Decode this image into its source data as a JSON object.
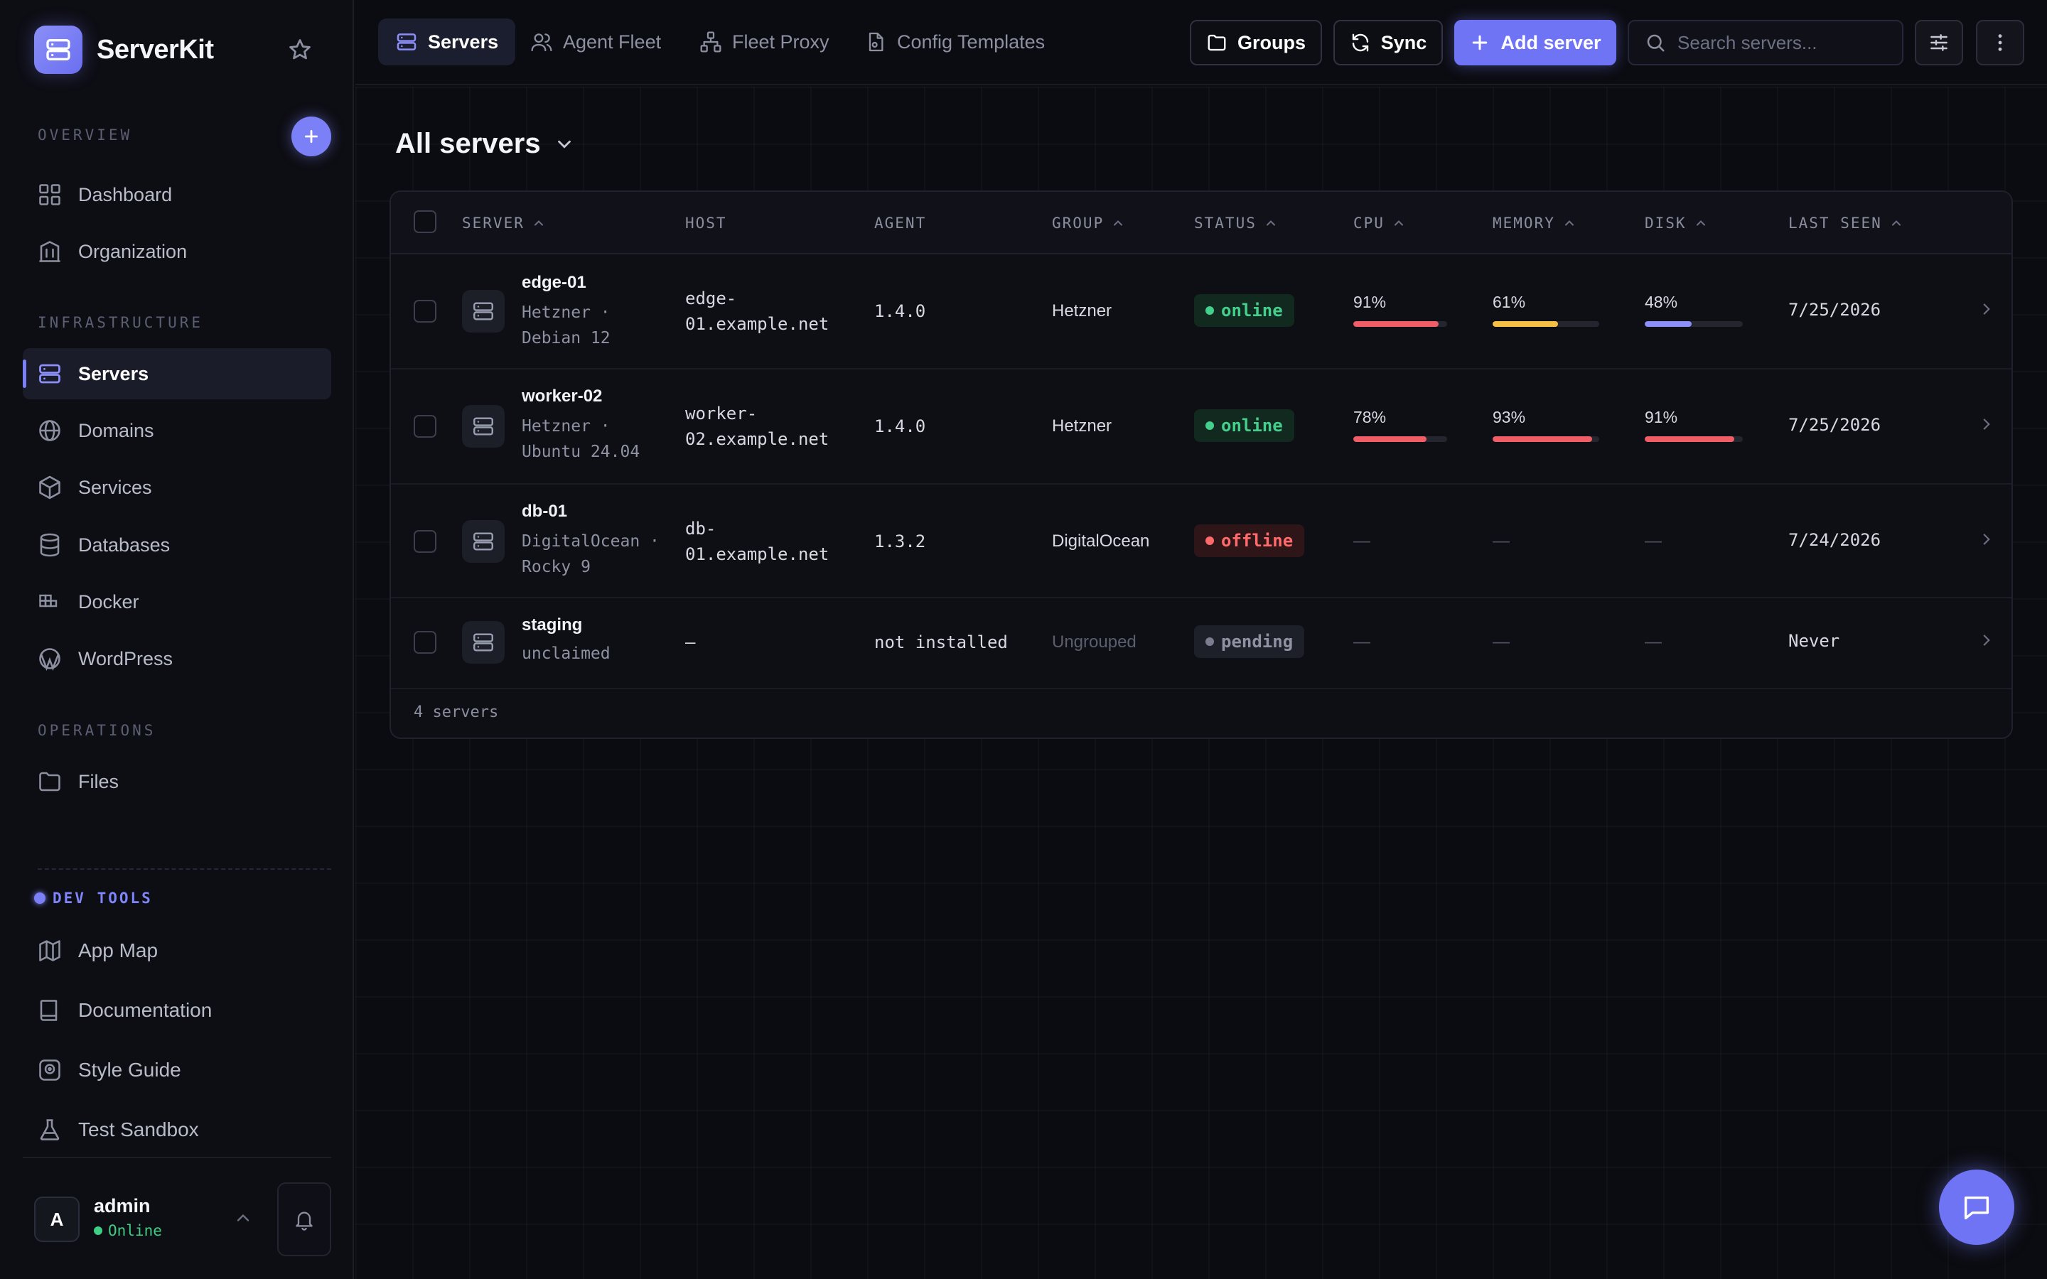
{
  "app": {
    "name": "ServerKit"
  },
  "sidebar": {
    "overview_label": "OVERVIEW",
    "infrastructure_label": "INFRASTRUCTURE",
    "operations_label": "OPERATIONS",
    "dev_tools_label": "DEV TOOLS",
    "overview_items": [
      {
        "label": "Dashboard",
        "icon": "grid-icon"
      },
      {
        "label": "Organization",
        "icon": "building-icon"
      }
    ],
    "infrastructure_items": [
      {
        "label": "Servers",
        "icon": "server-icon",
        "active": true
      },
      {
        "label": "Domains",
        "icon": "globe-icon"
      },
      {
        "label": "Services",
        "icon": "box-icon"
      },
      {
        "label": "Databases",
        "icon": "database-icon"
      },
      {
        "label": "Docker",
        "icon": "docker-icon"
      },
      {
        "label": "WordPress",
        "icon": "wordpress-icon"
      }
    ],
    "operations_items": [
      {
        "label": "Files",
        "icon": "folder-icon"
      }
    ],
    "dev_items": [
      {
        "label": "App Map",
        "icon": "map-icon"
      },
      {
        "label": "Documentation",
        "icon": "book-icon"
      },
      {
        "label": "Style Guide",
        "icon": "palette-icon"
      },
      {
        "label": "Test Sandbox",
        "icon": "flask-icon"
      }
    ],
    "user": {
      "initial": "A",
      "name": "admin",
      "status": "Online"
    }
  },
  "topbar": {
    "tabs": [
      {
        "label": "Servers",
        "icon": "server-icon",
        "active": true
      },
      {
        "label": "Agent Fleet",
        "icon": "users-icon"
      },
      {
        "label": "Fleet Proxy",
        "icon": "network-icon"
      },
      {
        "label": "Config Templates",
        "icon": "file-cog-icon"
      }
    ],
    "groups_label": "Groups",
    "sync_label": "Sync",
    "add_server_label": "Add server",
    "search_placeholder": "Search servers..."
  },
  "page": {
    "title": "All servers"
  },
  "table": {
    "columns": [
      "SERVER",
      "HOST",
      "AGENT",
      "GROUP",
      "STATUS",
      "CPU",
      "MEMORY",
      "DISK",
      "LAST SEEN"
    ],
    "rows": [
      {
        "name": "edge-01",
        "sub": "Hetzner · Debian 12",
        "host": "edge-01.example.net",
        "agent": "1.4.0",
        "group": "Hetzner",
        "status": "online",
        "cpu": "91%",
        "memory": "61%",
        "disk": "48%",
        "last_seen": "7/25/2026"
      },
      {
        "name": "worker-02",
        "sub": "Hetzner · Ubuntu 24.04",
        "host": "worker-02.example.net",
        "agent": "1.4.0",
        "group": "Hetzner",
        "status": "online",
        "cpu": "78%",
        "memory": "93%",
        "disk": "91%",
        "last_seen": "7/25/2026"
      },
      {
        "name": "db-01",
        "sub": "DigitalOcean · Rocky 9",
        "host": "db-01.example.net",
        "agent": "1.3.2",
        "group": "DigitalOcean",
        "status": "offline",
        "cpu": "—",
        "memory": "—",
        "disk": "—",
        "last_seen": "7/24/2026"
      },
      {
        "name": "staging",
        "sub": "unclaimed",
        "host": "—",
        "agent": "not installed",
        "group": "Ungrouped",
        "status": "pending",
        "cpu": "—",
        "memory": "—",
        "disk": "—",
        "last_seen": "Never"
      }
    ],
    "footer": "4 servers"
  },
  "colors": {
    "accent": "#6f74f5",
    "online": "#44d08c",
    "offline": "#ff6b6b",
    "bar_high": "#f05d66",
    "bar_mid": "#f5c044",
    "bar_low": "#8b8ff7"
  }
}
